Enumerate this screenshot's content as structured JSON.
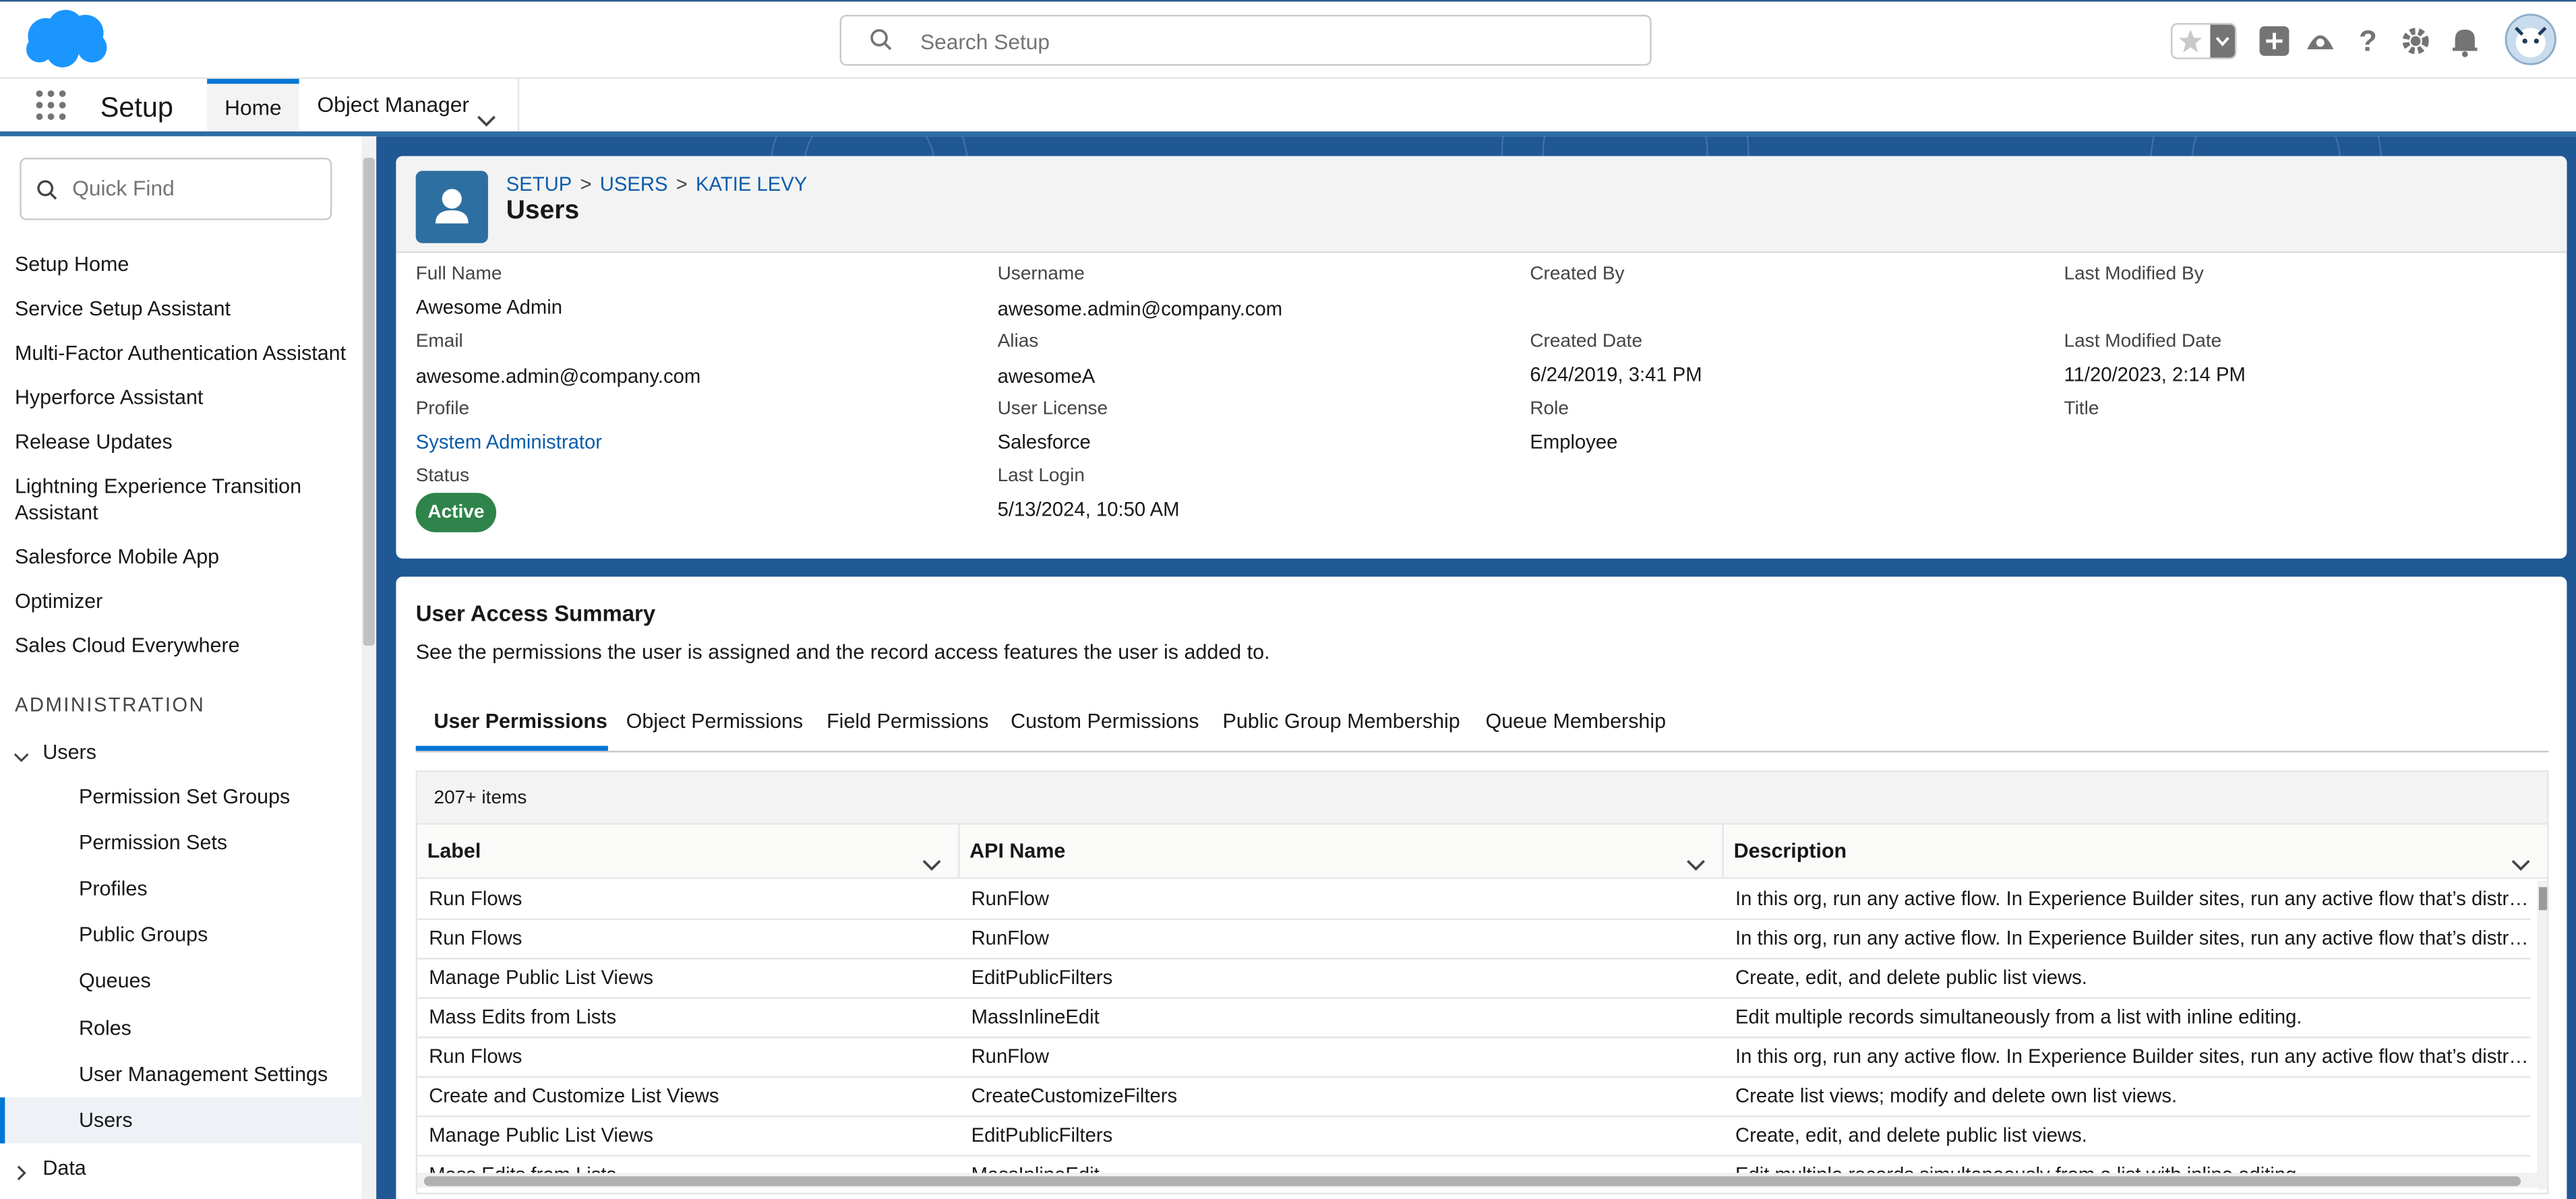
{
  "header": {
    "search_placeholder": "Search Setup"
  },
  "nav": {
    "app_name": "Setup",
    "tabs": [
      {
        "label": "Home",
        "selected": true
      },
      {
        "label": "Object Manager",
        "selected": false
      }
    ]
  },
  "sidebar": {
    "quick_find_placeholder": "Quick Find",
    "items": [
      "Setup Home",
      "Service Setup Assistant",
      "Multi-Factor Authentication Assistant",
      "Hyperforce Assistant",
      "Release Updates",
      "Lightning Experience Transition Assistant",
      "Salesforce Mobile App",
      "Optimizer",
      "Sales Cloud Everywhere"
    ],
    "section_heading": "ADMINISTRATION",
    "users_group": "Users",
    "users_children": [
      "Permission Set Groups",
      "Permission Sets",
      "Profiles",
      "Public Groups",
      "Queues",
      "Roles",
      "User Management Settings",
      "Users"
    ],
    "selected_child": "Users",
    "data_group": "Data"
  },
  "record": {
    "breadcrumb": [
      "SETUP",
      "USERS",
      "KATIE LEVY"
    ],
    "breadcrumb_sep": ">",
    "title": "Users",
    "fields": {
      "full_name": {
        "label": "Full Name",
        "value": "Awesome Admin"
      },
      "email": {
        "label": "Email",
        "value": "awesome.admin@company.com"
      },
      "profile": {
        "label": "Profile",
        "value": "System Administrator"
      },
      "status": {
        "label": "Status",
        "value": "Active"
      },
      "username": {
        "label": "Username",
        "value": "awesome.admin@company.com"
      },
      "alias": {
        "label": "Alias",
        "value": "awesomeA"
      },
      "user_license": {
        "label": "User License",
        "value": "Salesforce"
      },
      "last_login": {
        "label": "Last Login",
        "value": "5/13/2024, 10:50 AM"
      },
      "created_by": {
        "label": "Created By",
        "value": ""
      },
      "created_date": {
        "label": "Created Date",
        "value": "6/24/2019, 3:41 PM"
      },
      "role": {
        "label": "Role",
        "value": "Employee"
      },
      "last_modified_by": {
        "label": "Last Modified By",
        "value": ""
      },
      "last_modified_date": {
        "label": "Last Modified Date",
        "value": "11/20/2023, 2:14 PM"
      },
      "title": {
        "label": "Title",
        "value": ""
      }
    },
    "status_color": "#2e844a"
  },
  "access_summary": {
    "title": "User Access Summary",
    "description": "See the permissions the user is assigned and the record access features the user is added to.",
    "tabs": [
      "User Permissions",
      "Object Permissions",
      "Field Permissions",
      "Custom Permissions",
      "Public Group Membership",
      "Queue Membership"
    ],
    "selected_tab": "User Permissions",
    "item_count": "207+ items",
    "columns": [
      "Label",
      "API Name",
      "Description"
    ],
    "rows": [
      [
        "Run Flows",
        "RunFlow",
        "In this org, run any active flow. In Experience Builder sites, run any active flow that’s distrib..."
      ],
      [
        "Run Flows",
        "RunFlow",
        "In this org, run any active flow. In Experience Builder sites, run any active flow that’s distrib..."
      ],
      [
        "Manage Public List Views",
        "EditPublicFilters",
        "Create, edit, and delete public list views."
      ],
      [
        "Mass Edits from Lists",
        "MassInlineEdit",
        "Edit multiple records simultaneously from a list with inline editing."
      ],
      [
        "Run Flows",
        "RunFlow",
        "In this org, run any active flow. In Experience Builder sites, run any active flow that’s distrib..."
      ],
      [
        "Create and Customize List Views",
        "CreateCustomizeFilters",
        "Create list views; modify and delete own list views."
      ],
      [
        "Manage Public List Views",
        "EditPublicFilters",
        "Create, edit, and delete public list views."
      ],
      [
        "Mass Edits from Lists",
        "MassInlineEdit",
        "Edit multiple records simultaneously from a list with inline editing."
      ]
    ]
  },
  "colors": {
    "brand_blue": "#0176d3",
    "link": "#0b5cab",
    "banner": "#1f5894"
  }
}
